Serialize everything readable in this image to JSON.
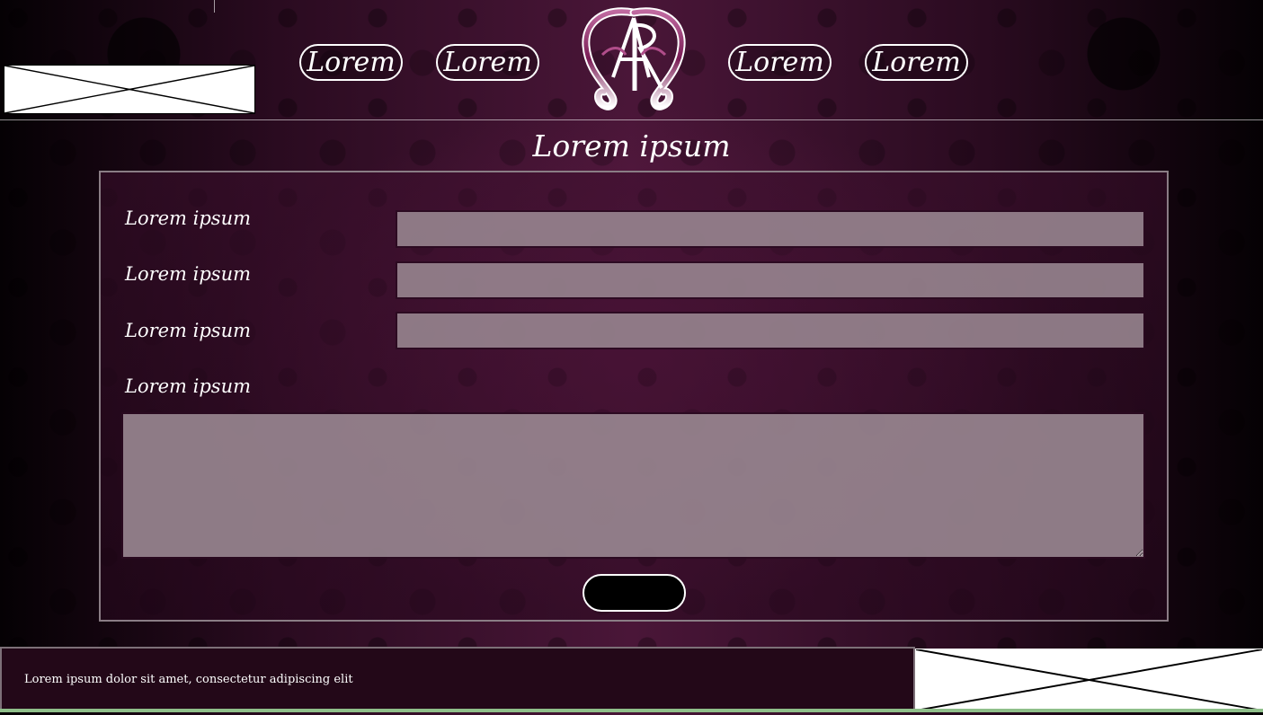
{
  "header": {
    "nav_left": [
      {
        "label": "Lorem"
      },
      {
        "label": "Lorem"
      }
    ],
    "nav_right": [
      {
        "label": "Lorem"
      },
      {
        "label": "Lorem"
      }
    ],
    "logo_text": "AR"
  },
  "main": {
    "title": "Lorem ipsum",
    "fields": [
      {
        "label": "Lorem ipsum",
        "value": "",
        "placeholder": ""
      },
      {
        "label": "Lorem ipsum",
        "value": "",
        "placeholder": ""
      },
      {
        "label": "Lorem ipsum",
        "value": "",
        "placeholder": ""
      }
    ],
    "message": {
      "label": "Lorem ipsum",
      "value": "",
      "placeholder": ""
    },
    "submit_label": ""
  },
  "footer": {
    "text": "Lorem ipsum dolor sit amet, consectetur adipiscing elit"
  },
  "colors": {
    "accent": "#8b2a6a",
    "input_fill": "#9a8892",
    "panel_border": "#8a7d85",
    "footer_bg": "#230818",
    "bottom_strip": "#8fbf8a"
  }
}
